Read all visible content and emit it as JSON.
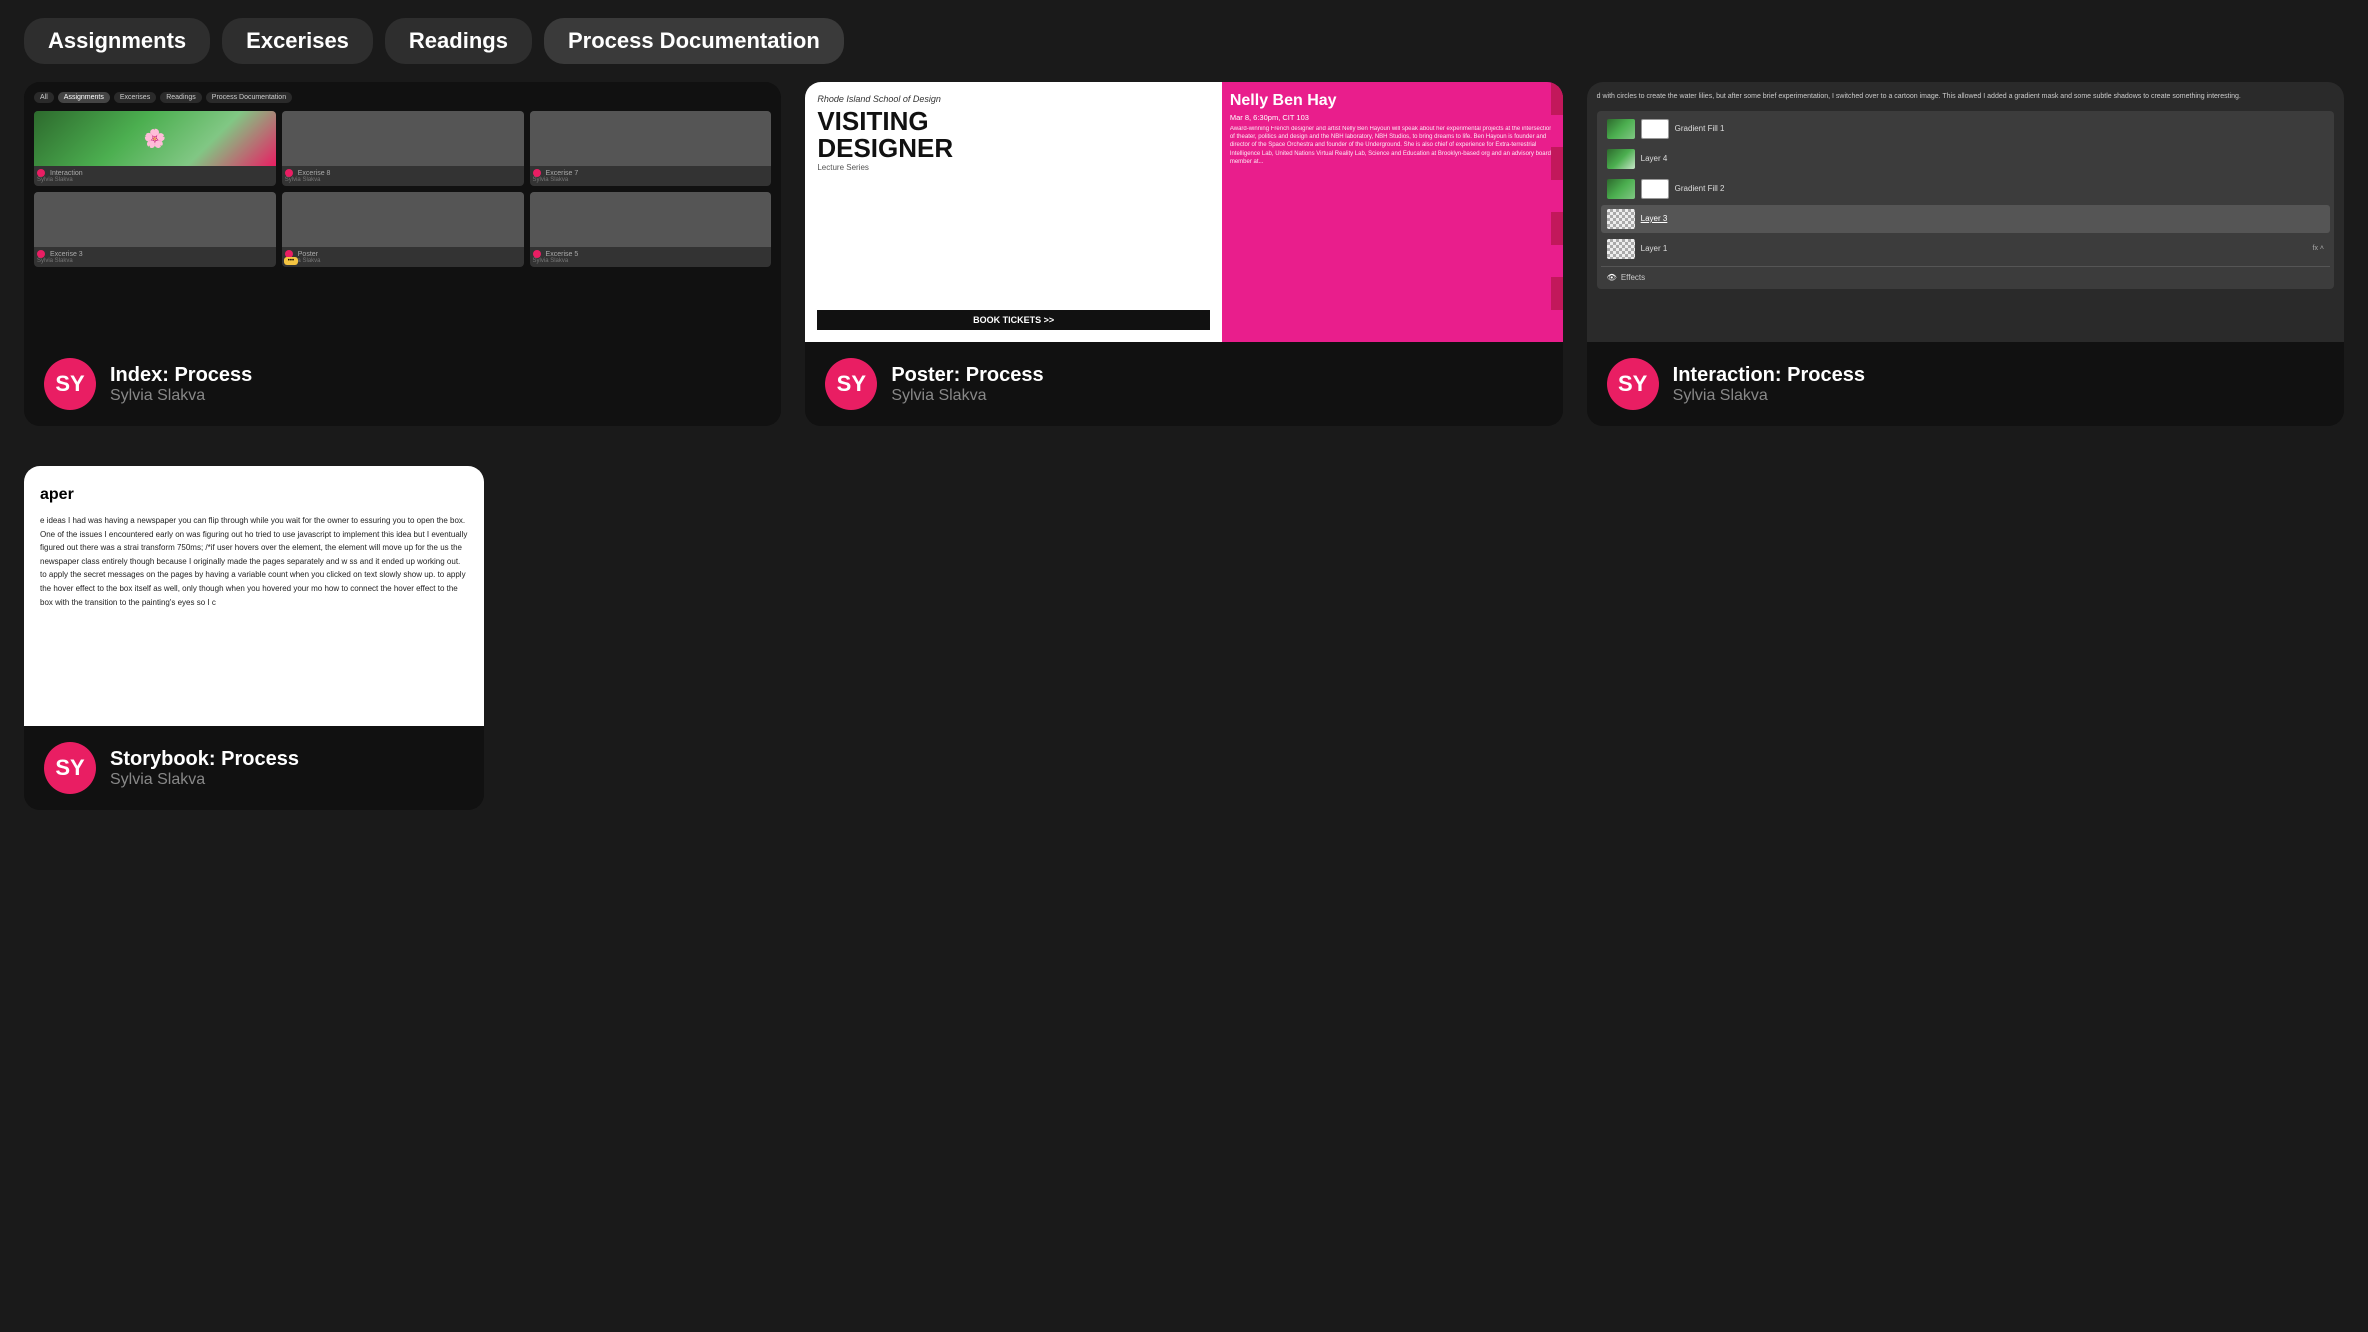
{
  "nav": {
    "tabs": [
      {
        "label": "Assignments",
        "active": false
      },
      {
        "label": "Excerises",
        "active": false
      },
      {
        "label": "Readings",
        "active": false
      },
      {
        "label": "Process Documentation",
        "active": true
      }
    ]
  },
  "cards": [
    {
      "id": "index",
      "title": "Index: Process",
      "author": "Sylvia Slakva",
      "avatar_initials": "SY"
    },
    {
      "id": "poster",
      "title": "Poster: Process",
      "author": "Sylvia Slakva",
      "avatar_initials": "SY",
      "poster": {
        "school": "Rhode Island School of Design",
        "heading_line1": "VISITING",
        "heading_line2": "DESIGNER",
        "lecture": "Lecture Series",
        "book_btn": "BOOK TICKETS >>",
        "name": "Nelly Ben Hay",
        "date": "Mar 8, 6:30pm, CIT 103",
        "desc": "Award-winning French designer and artist Nelly Ben Hayoun will speak about her experimental projects at the intersection of theater, politics and design and the NBH laboratory, NBH Studios, to bring dreams to life. Ben Hayoun is founder and director of the Space Orchestra and founder of the Underground. She is also chief of experience for Extra-terrestrial Intelligence Lab, United Nations Virtual Reality Lab, Science and Education at Brooklyn-based org and an advisory board member at..."
      }
    },
    {
      "id": "interaction",
      "title": "Interaction: Process",
      "author": "Sylvia Slakva",
      "avatar_initials": "SY",
      "interaction": {
        "top_text": "d with circles to create the water lilies, but after some brief experimentation, I switched over to a cartoon image. This allowed I added a gradient mask and some subtle shadows to create something interesting.",
        "layers": [
          {
            "name": "Gradient Fill 1",
            "type": "gradient-white",
            "selected": false
          },
          {
            "name": "Layer 4",
            "type": "green",
            "selected": false
          },
          {
            "name": "Gradient Fill 2",
            "type": "gradient-white",
            "selected": false
          },
          {
            "name": "Layer 3",
            "type": "checker",
            "selected": true
          },
          {
            "name": "Layer 1",
            "type": "checker",
            "selected": false,
            "fx": true
          }
        ]
      }
    }
  ],
  "storybook": {
    "title": "Storybook: Process",
    "author": "Sylvia Slakva",
    "avatar_initials": "SY",
    "preview_title": "aper",
    "preview_body": "e ideas I had was having a newspaper you can flip through while you wait for the owner to essuring you to open the box. One of the issues I encountered early on was figuring out ho tried to use javascript to implement this idea but I eventually figured out there was a strai\n\ntransform 750ms; /*if user hovers over the element, the element will move up for the us\n\nthe newspaper class entirely though because I originally made the pages separately and w ss and it ended up working out.\n\nto apply the secret messages on the pages by having a variable count when you clicked on text slowly show up.\n\nto apply the hover effect to the box itself as well, only though when you hovered your mo how to connect the hover effect to the box with the transition to the painting's eyes so I c"
  },
  "colors": {
    "accent": "#e91e63",
    "background": "#1a1a1a",
    "card_bg": "#111",
    "nav_tab": "#2e2e2e"
  }
}
